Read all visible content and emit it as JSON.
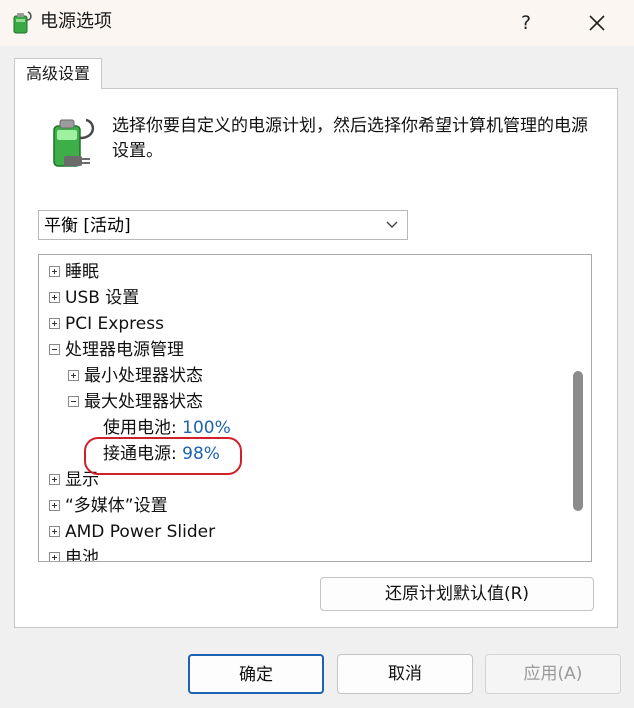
{
  "window": {
    "title": "电源选项",
    "help_label": "?",
    "icon": "power-options-icon"
  },
  "tabs": [
    {
      "label": "高级设置",
      "selected": true
    }
  ],
  "description": "选择你要自定义的电源计划，然后选择你希望计算机管理的电源设置。",
  "plan_select": {
    "value": "平衡 [活动]"
  },
  "tree": {
    "items": [
      {
        "label": "睡眠",
        "expander": "plus"
      },
      {
        "label": "USB 设置",
        "expander": "plus"
      },
      {
        "label": "PCI Express",
        "expander": "plus"
      },
      {
        "label": "处理器电源管理",
        "expander": "minus"
      },
      {
        "label": "最小处理器状态",
        "expander": "plus"
      },
      {
        "label": "最大处理器状态",
        "expander": "minus"
      },
      {
        "label": "使用电池:",
        "value": "100%"
      },
      {
        "label": "接通电源:",
        "value": "98%"
      },
      {
        "label": "显示",
        "expander": "plus"
      },
      {
        "label": "“多媒体”设置",
        "expander": "plus"
      },
      {
        "label": "AMD Power Slider",
        "expander": "plus"
      },
      {
        "label": "电池",
        "expander": "plus"
      }
    ]
  },
  "buttons": {
    "restore": "还原计划默认值(R)",
    "ok": "确定",
    "cancel": "取消",
    "apply": "应用(A)"
  },
  "colors": {
    "highlight_ring": "#d0202a",
    "value_text": "#1d62b0"
  }
}
